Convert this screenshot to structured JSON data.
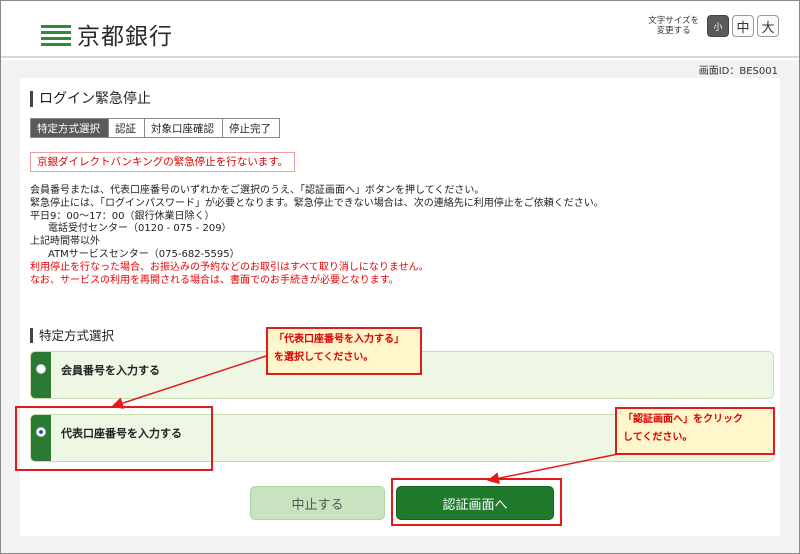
{
  "header": {
    "logo_text": "京都銀行",
    "fontsize_label_line1": "文字サイズを",
    "fontsize_label_line2": "変更する",
    "fontsize_small": "小",
    "fontsize_medium": "中",
    "fontsize_large": "大"
  },
  "screen_id": "画面ID：BES001",
  "page_title": "ログイン緊急停止",
  "steps": [
    "特定方式選択",
    "認証",
    "対象口座確認",
    "停止完了"
  ],
  "alert": "京銀ダイレクトバンキングの緊急停止を行ないます。",
  "body": {
    "line1": "会員番号または、代表口座番号のいずれかをご選択のうえ、「認証画面へ」ボタンを押してください。",
    "line2": "緊急停止には、「ログインパスワード」が必要となります。緊急停止できない場合は、次の連絡先に利用停止をご依頼ください。",
    "line3": "平日9：00〜17：00（銀行休業日除く）",
    "line4": "電話受付センター（0120 - 075 - 209）",
    "line5": "上記時間帯以外",
    "line6": "ATMサービスセンター（075-682-5595）",
    "line7": "利用停止を行なった場合、お振込みの予約などのお取引はすべて取り消しになりません。",
    "line8": "なお、サービスの利用を再開される場合は、書面でのお手続きが必要となります。"
  },
  "section_title": "特定方式選択",
  "options": [
    {
      "label": "会員番号を入力する",
      "checked": false
    },
    {
      "label": "代表口座番号を入力する",
      "checked": true
    }
  ],
  "callouts": {
    "c1_line1": "「代表口座番号を入力する」",
    "c1_line2": "を選択してください。",
    "c2_line1": "「認証画面へ」をクリック",
    "c2_line2": "してください。"
  },
  "buttons": {
    "cancel": "中止する",
    "auth": "認証画面へ"
  },
  "colors": {
    "brand_green": "#2a7a34",
    "alert_red": "#e00000",
    "callout_bg": "#fff6cc"
  }
}
